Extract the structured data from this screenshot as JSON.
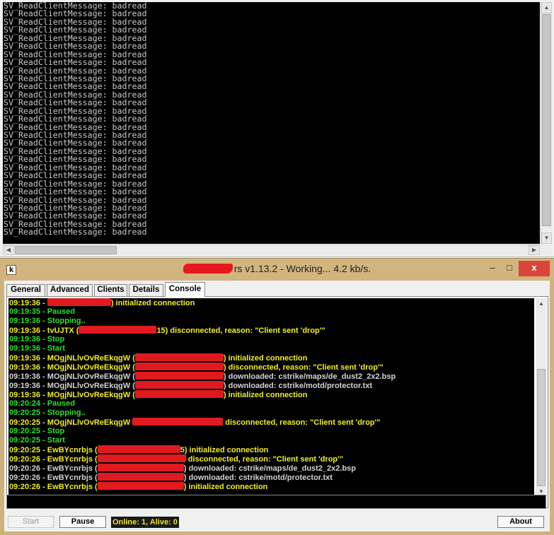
{
  "top_console": {
    "lines": [
      "SV_ReadClientMessage: badread",
      "SV_ReadClientMessage: badread",
      "SV_ReadClientMessage: badread",
      "SV_ReadClientMessage: badread",
      "SV_ReadClientMessage: badread",
      "SV_ReadClientMessage: badread",
      "SV_ReadClientMessage: badread",
      "SV_ReadClientMessage: badread",
      "SV_ReadClientMessage: badread",
      "SV_ReadClientMessage: badread",
      "SV_ReadClientMessage: badread",
      "SV_ReadClientMessage: badread",
      "SV_ReadClientMessage: badread",
      "SV_ReadClientMessage: badread",
      "SV_ReadClientMessage: badread",
      "SV_ReadClientMessage: badread",
      "SV_ReadClientMessage: badread",
      "SV_ReadClientMessage: badread",
      "SV_ReadClientMessage: badread",
      "SV_ReadClientMessage: badread",
      "SV_ReadClientMessage: badread",
      "SV_ReadClientMessage: badread",
      "SV_ReadClientMessage: badread",
      "SV_ReadClientMessage: badread",
      "SV_ReadClientMessage: badread",
      "SV_ReadClientMessage: badread",
      "SV_ReadClientMessage: badread",
      "SV_ReadClientMessage: badread",
      "SV_ReadClientMessage: badread"
    ]
  },
  "window": {
    "title": "rs v1.13.2 - Working... 4.2 kb/s.",
    "close_label": "x",
    "minimize_label": "–",
    "maximize_label": "□",
    "app_icon_glyph": "k"
  },
  "tabs": {
    "general": "General",
    "advanced": "Advanced",
    "clients": "Clients",
    "details": "Details",
    "console": "Console"
  },
  "log": {
    "lines": [
      {
        "color": "yellow",
        "before": "09:19:36 - ",
        "redact": 90,
        "after": ") initialized connection"
      },
      {
        "color": "green",
        "before": "09:19:35 - Paused"
      },
      {
        "color": "green",
        "before": "09:19:36 - Stopping.."
      },
      {
        "color": "yellow",
        "before": "09:19:36 - tvUJTX (",
        "redact": 110,
        "after": "15) disconnected, reason: \"Client sent 'drop'\""
      },
      {
        "color": "green",
        "before": "09:19:36 - Stop"
      },
      {
        "color": "green",
        "before": "09:19:36 - Start"
      },
      {
        "color": "yellow",
        "before": "09:19:36 - MOgjNLlvOvReEkqgW (",
        "redact": 125,
        "after": ") initialized connection"
      },
      {
        "color": "yellow",
        "before": "09:19:36 - MOgjNLlvOvReEkqgW (",
        "redact": 125,
        "after": ") disconnected, reason: \"Client sent 'drop'\""
      },
      {
        "color": "gray",
        "before": "09:19:36 - MOgjNLlvOvReEkqgW (",
        "redact": 125,
        "after": ") downloaded: cstrike/maps/de_dust2_2x2.bsp"
      },
      {
        "color": "gray",
        "before": "09:19:36 - MOgjNLlvOvReEkqgW (",
        "redact": 125,
        "after": ") downloaded: cstrike/motd/protector.txt"
      },
      {
        "color": "yellow",
        "before": "09:19:36 - MOgjNLlvOvReEkqgW (",
        "redact": 125,
        "after": ") initialized connection"
      },
      {
        "color": "green",
        "before": "09:20:24 - Paused"
      },
      {
        "color": "green",
        "before": "09:20:25 - Stopping.."
      },
      {
        "color": "yellow",
        "before": "09:20:25 - MOgjNLlvOvReEkqgW ",
        "redact": 128,
        "after": " disconnected, reason: \"Client sent 'drop'\""
      },
      {
        "color": "green",
        "before": "09:20:25 - Stop"
      },
      {
        "color": "green",
        "before": "09:20:25 - Start"
      },
      {
        "color": "yellow",
        "before": "09:20:25 - EwBYcnrbjs (",
        "redact": 117,
        "after": "5) initialized connection"
      },
      {
        "color": "yellow",
        "before": "09:20:26 - EwBYcnrbjs (",
        "redact": 125,
        "after": " disconnected, reason: \"Client sent 'drop'\""
      },
      {
        "color": "gray",
        "before": "09:20:26 - EwBYcnrbjs (",
        "redact": 122,
        "after": ") downloaded: cstrike/maps/de_dust2_2x2.bsp"
      },
      {
        "color": "gray",
        "before": "09:20:26 - EwBYcnrbjs (",
        "redact": 122,
        "after": ") downloaded: cstrike/motd/protector.txt"
      },
      {
        "color": "yellow",
        "before": "09:20:26 - EwBYcnrbjs (",
        "redact": 122,
        "after": ") initialized connection"
      }
    ]
  },
  "command": {
    "value": ""
  },
  "buttons": {
    "start": "Start",
    "pause": "Pause",
    "about": "About"
  },
  "status": "Online: 1, Alive: 0",
  "colors": {
    "log_green": "#27e32c",
    "log_yellow": "#f3ef1c",
    "log_gray": "#d4d4d4",
    "redaction": "#e01a1f",
    "titlebar": "#d2b47e",
    "close_button": "#d9453c"
  },
  "icons": {
    "window_icon": "running-man-icon",
    "scroll_up": "triangle-up",
    "scroll_down": "triangle-down",
    "scroll_left": "triangle-left",
    "scroll_right": "triangle-right"
  }
}
